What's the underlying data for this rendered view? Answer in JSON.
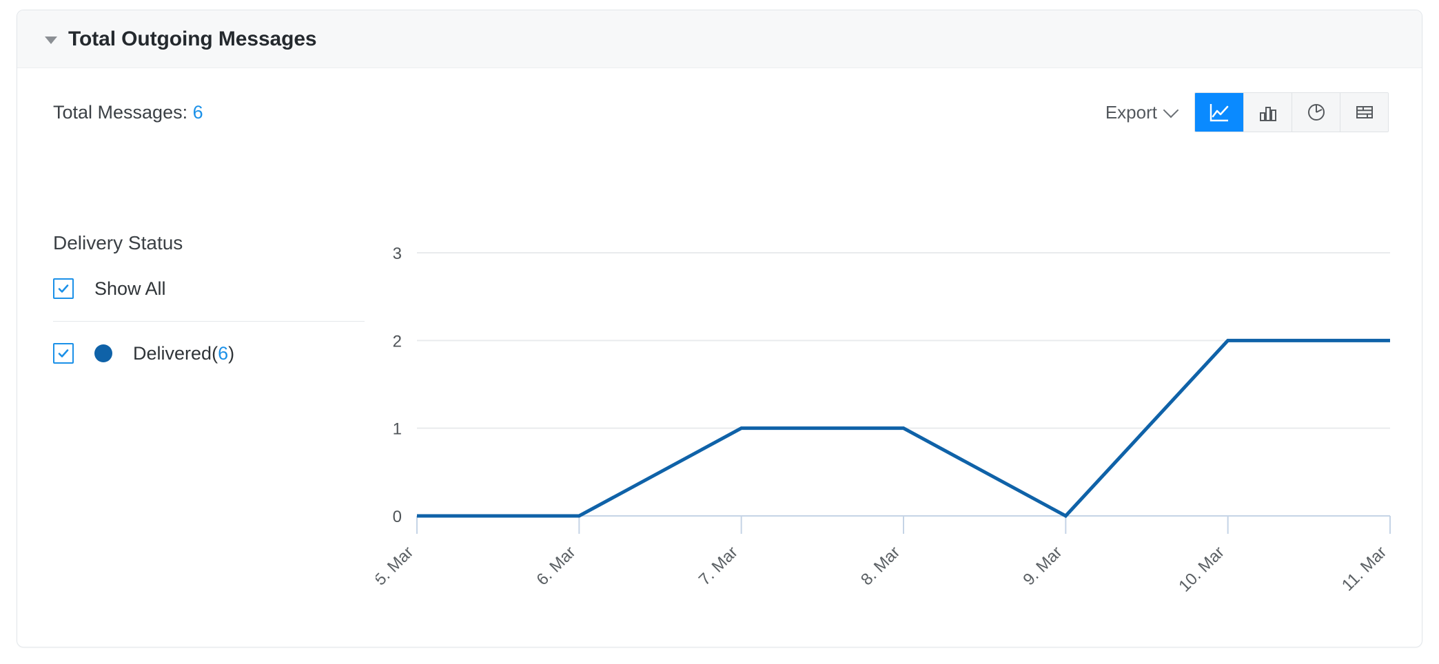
{
  "card": {
    "title": "Total Outgoing Messages",
    "collapse_icon": "caret-down-icon"
  },
  "toolbar": {
    "total_messages_label": "Total Messages:",
    "total_messages_value": "6",
    "export_label": "Export",
    "export_chevron_icon": "chevron-down-icon",
    "chart_types": [
      {
        "name": "line-chart-icon",
        "label": "Line",
        "active": true
      },
      {
        "name": "bar-chart-icon",
        "label": "Bar",
        "active": false
      },
      {
        "name": "pie-chart-icon",
        "label": "Pie",
        "active": false
      },
      {
        "name": "table-icon",
        "label": "Table",
        "active": false
      }
    ]
  },
  "legend": {
    "heading": "Delivery Status",
    "show_all_label": "Show All",
    "show_all_checked": true,
    "items": [
      {
        "label": "Delivered",
        "count": "6",
        "open_paren": "(",
        "close_paren": ")",
        "color": "#0f62a8",
        "checked": true
      }
    ]
  },
  "colors": {
    "accent_blue": "#1a90e8",
    "active_button_blue": "#0a8aff",
    "series_blue": "#0f62a8",
    "header_bg": "#f7f8f9",
    "card_border": "#e2e6ea"
  },
  "chart_data": {
    "type": "line",
    "title": "Total Outgoing Messages",
    "xlabel": "",
    "ylabel": "",
    "categories": [
      "5. Mar",
      "6. Mar",
      "7. Mar",
      "8. Mar",
      "9. Mar",
      "10. Mar",
      "11. Mar"
    ],
    "series": [
      {
        "name": "Delivered",
        "color": "#0f62a8",
        "values": [
          0,
          0,
          1,
          1,
          0,
          2,
          2
        ]
      }
    ],
    "ylim": [
      0,
      3
    ],
    "yticks": [
      0,
      1,
      2,
      3
    ],
    "grid": true,
    "legend_position": "left",
    "xtick_rotation": -45
  }
}
